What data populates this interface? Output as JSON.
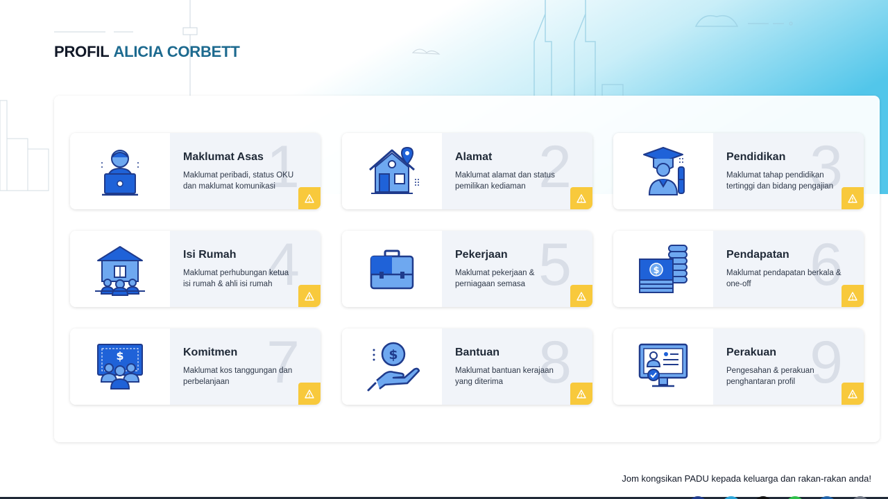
{
  "header": {
    "prefix": "PROFIL",
    "name": "ALICIA CORBETT"
  },
  "cards": [
    {
      "number": "1",
      "title": "Maklumat Asas",
      "description": "Maklumat peribadi, status OKU\ndan maklumat komunikasi",
      "icon": "person-laptop-icon"
    },
    {
      "number": "2",
      "title": "Alamat",
      "description": "Maklumat alamat dan status\npemilikan kediaman",
      "icon": "house-location-icon"
    },
    {
      "number": "3",
      "title": "Pendidikan",
      "description": "Maklumat tahap pendidikan\ntertinggi dan bidang pengajian",
      "icon": "graduate-icon"
    },
    {
      "number": "4",
      "title": "Isi Rumah",
      "description": "Maklumat perhubungan ketua\nisi rumah & ahli isi rumah",
      "icon": "household-icon"
    },
    {
      "number": "5",
      "title": "Pekerjaan",
      "description": "Maklumat pekerjaan &\nperniagaan semasa",
      "icon": "briefcase-icon"
    },
    {
      "number": "6",
      "title": "Pendapatan",
      "description": "Maklumat pendapatan berkala &\none-off",
      "icon": "money-stack-icon"
    },
    {
      "number": "7",
      "title": "Komitmen",
      "description": "Maklumat kos tanggungan dan\nperbelanjaan",
      "icon": "family-money-icon"
    },
    {
      "number": "8",
      "title": "Bantuan",
      "description": "Maklumat bantuan kerajaan\nyang diterima",
      "icon": "hand-coin-icon"
    },
    {
      "number": "9",
      "title": "Perakuan",
      "description": "Pengesahan & perakuan\npenghantaran profil",
      "icon": "verified-profile-icon"
    }
  ],
  "footer": {
    "share_text": "Jom kongsikan PADU kepada keluarga dan rakan-rakan anda!"
  },
  "colors": {
    "accent": "#1d6a8f",
    "icon_blue": "#1f62d8",
    "warning": "#f8c93c",
    "sky": "#5cc9ea"
  }
}
